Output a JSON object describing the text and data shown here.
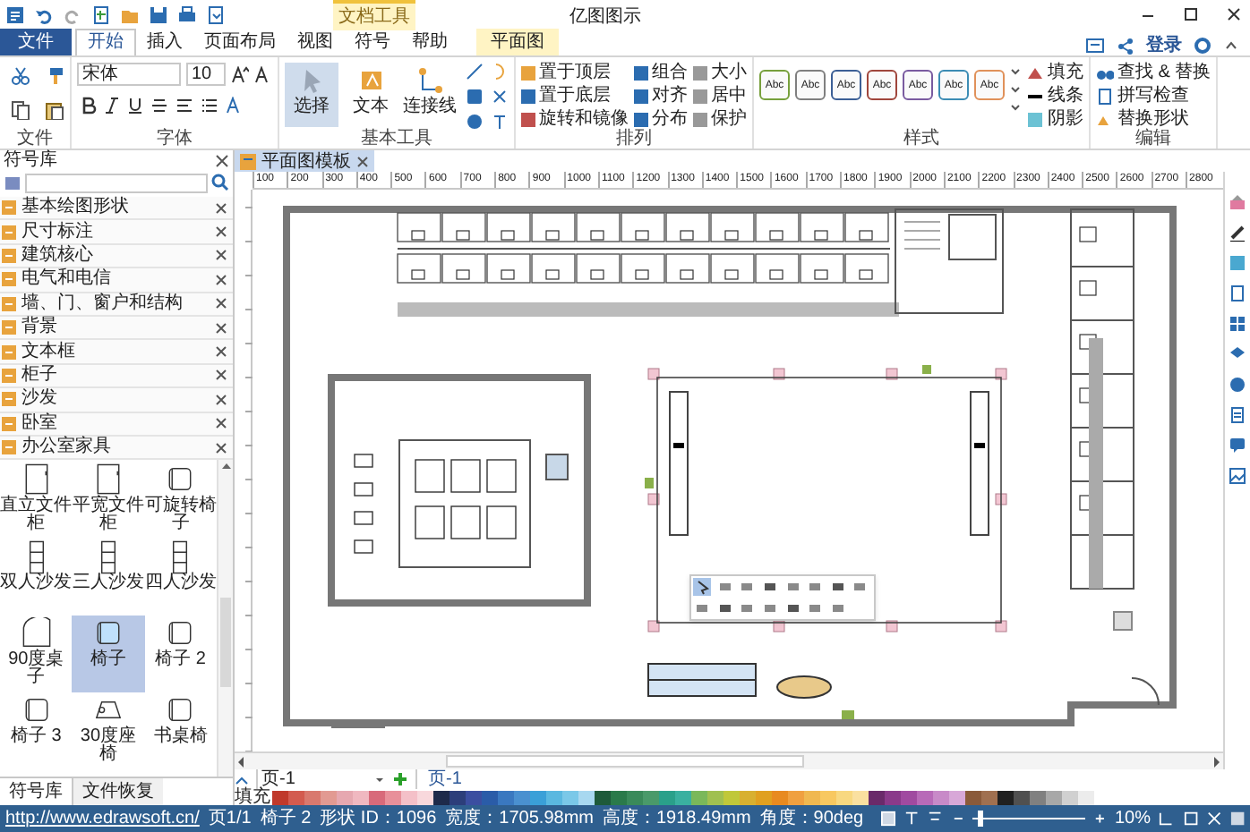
{
  "window": {
    "title": "亿图图示"
  },
  "account": {
    "login": "登录"
  },
  "menu_tabs": [
    {
      "label": "文件",
      "kind": "file",
      "selected": false
    },
    {
      "label": "开始",
      "kind": "tab",
      "selected": true
    },
    {
      "label": "插入",
      "kind": "tab",
      "selected": false
    },
    {
      "label": "页面布局",
      "kind": "tab",
      "selected": false
    },
    {
      "label": "视图",
      "kind": "tab",
      "selected": false
    },
    {
      "label": "符号",
      "kind": "tab",
      "selected": false
    },
    {
      "label": "帮助",
      "kind": "tab",
      "selected": false
    },
    {
      "label": "平面图",
      "kind": "context",
      "group": "文档工具",
      "selected": false
    }
  ],
  "ribbon": {
    "font_family": "宋体",
    "font_size": "10",
    "groups": [
      {
        "label": "文件"
      },
      {
        "label": "字体"
      },
      {
        "label": "基本工具",
        "tools": [
          {
            "label": "选择",
            "selected": true
          },
          {
            "label": "文本",
            "selected": false
          },
          {
            "label": "连接线",
            "selected": false
          }
        ]
      },
      {
        "label": "排列",
        "columns": [
          [
            "置于顶层",
            "置于底层",
            "旋转和镜像"
          ],
          [
            "组合",
            "对齐",
            "分布"
          ],
          [
            "大小",
            "居中",
            "保护"
          ]
        ]
      },
      {
        "label": "样式",
        "swatches": [
          {
            "label": "Abc",
            "color": "#77a03c"
          },
          {
            "label": "Abc",
            "color": "#7f7f7f"
          },
          {
            "label": "Abc",
            "color": "#3c5f96"
          },
          {
            "label": "Abc",
            "color": "#a0463c"
          },
          {
            "label": "Abc",
            "color": "#7a5ba0"
          },
          {
            "label": "Abc",
            "color": "#3c8cb4"
          },
          {
            "label": "Abc",
            "color": "#e0915a"
          }
        ],
        "commands": [
          "填充",
          "线条",
          "阴影"
        ]
      },
      {
        "label": "编辑",
        "commands": [
          "查找 & 替换",
          "拼写检查",
          "替换形状"
        ]
      }
    ]
  },
  "library": {
    "title": "符号库",
    "categories": [
      "基本绘图形状",
      "尺寸标注",
      "建筑核心",
      "电气和电信",
      "墙、门、窗户和结构",
      "背景",
      "文本框",
      "柜子",
      "沙发",
      "卧室",
      "办公室家具"
    ],
    "shapes": [
      {
        "label": "直立文件柜",
        "kind": "cabinet",
        "selected": false
      },
      {
        "label": "平宽文件柜",
        "kind": "cabinet",
        "selected": false
      },
      {
        "label": "可旋转椅子",
        "kind": "chair",
        "selected": false
      },
      {
        "label": "双人沙发",
        "kind": "sofa",
        "selected": false
      },
      {
        "label": "三人沙发",
        "kind": "sofa",
        "selected": false
      },
      {
        "label": "四人沙发",
        "kind": "sofa",
        "selected": false
      },
      {
        "label": "90度桌子",
        "kind": "desk",
        "selected": false
      },
      {
        "label": "椅子",
        "kind": "chair",
        "selected": true
      },
      {
        "label": "椅子 2",
        "kind": "chair",
        "selected": false
      },
      {
        "label": "椅子 3",
        "kind": "chair",
        "selected": false
      },
      {
        "label": "30度座椅",
        "kind": "seat",
        "selected": false
      },
      {
        "label": "书桌椅",
        "kind": "chair",
        "selected": false
      }
    ],
    "bottom_tabs": [
      {
        "label": "符号库",
        "selected": true
      },
      {
        "label": "文件恢复",
        "selected": false
      }
    ]
  },
  "document_tab": {
    "title": "平面图模板"
  },
  "ruler": {
    "ticks": [
      "100",
      "200",
      "300",
      "400",
      "500",
      "600",
      "700",
      "800",
      "900",
      "1000",
      "1100",
      "1200",
      "1300",
      "1400",
      "1500",
      "1600",
      "1700",
      "1800",
      "1900",
      "2000",
      "2100",
      "2200",
      "2300",
      "2400",
      "2500",
      "2600",
      "2700",
      "2800"
    ]
  },
  "pages": {
    "dropdown": "页-1",
    "tabs": [
      {
        "label": "页-1",
        "selected": true
      }
    ]
  },
  "palette": {
    "label": "填充"
  },
  "status_bar": {
    "url": "http://www.edrawsoft.cn/",
    "page": "页1/1",
    "shape": "椅子 2",
    "shape_id": "形状 ID：1096",
    "width": "宽度：1705.98mm",
    "height": "高度：1918.49mm",
    "angle": "角度：90deg",
    "zoom": "10%",
    "zoom_level": {
      "level": 0.05
    }
  }
}
